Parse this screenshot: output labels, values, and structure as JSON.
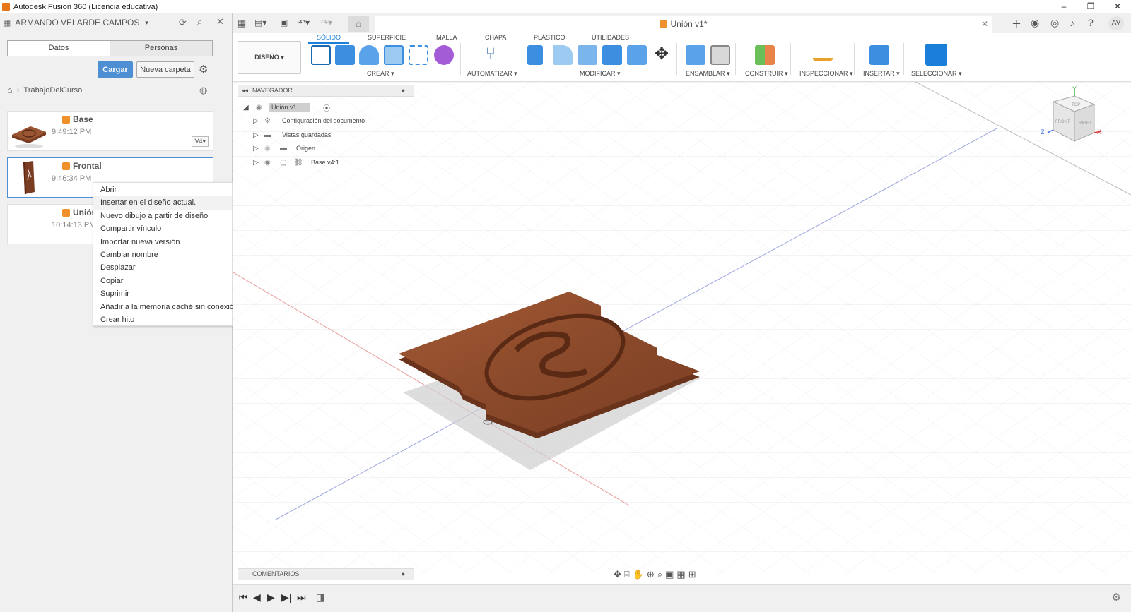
{
  "window": {
    "title": "Autodesk Fusion 360 (Licencia educativa)",
    "minimize": "–",
    "restore": "❐",
    "close": "✕"
  },
  "left_panel": {
    "user_name": "ARMANDO VELARDE CAMPOS",
    "tabs": [
      {
        "label": "Datos",
        "active": true
      },
      {
        "label": "Personas",
        "active": false
      }
    ],
    "upload_label": "Cargar",
    "new_folder_label": "Nueva carpeta",
    "breadcrumb": "TrabajoDelCurso",
    "files": [
      {
        "name": "Base",
        "time": "9:49:12 PM",
        "version": "V4▾"
      },
      {
        "name": "Frontal",
        "time": "9:46:34 PM"
      },
      {
        "name": "Unión",
        "time": "10:14:13 PM"
      }
    ]
  },
  "context_menu": {
    "items": [
      "Abrir",
      "Insertar en el diseño actual.",
      "Nuevo dibujo a partir de diseño",
      "Compartir vínculo",
      "Importar nueva versión",
      "Cambiar nombre",
      "Desplazar",
      "Copiar",
      "Suprimir",
      "Añadir a la memoria caché sin conexión",
      "Crear hito"
    ],
    "highlighted": 1
  },
  "doc_tab": {
    "title": "Unión v1*",
    "close": "✕"
  },
  "user_initials": "AV",
  "ribbon": {
    "tabs": [
      "SÓLIDO",
      "SUPERFICIE",
      "MALLA",
      "CHAPA",
      "PLÁSTICO",
      "UTILIDADES"
    ],
    "active_tab": "SÓLIDO",
    "workspace": "DISEÑO ▾",
    "groups": [
      "CREAR ▾",
      "AUTOMATIZAR ▾",
      "MODIFICAR ▾",
      "ENSAMBLAR ▾",
      "CONSTRUIR ▾",
      "INSPECCIONAR ▾",
      "INSERTAR ▾",
      "SELECCIONAR ▾"
    ]
  },
  "navigator": {
    "title": "NAVEGADOR",
    "root": "Unión v1",
    "items": [
      "Configuración del documento",
      "Vistas guardadas",
      "Origen",
      "Base v4:1"
    ]
  },
  "comments_label": "COMENTARIOS",
  "viewcube": {
    "top": "TOP",
    "front": "FRONT",
    "right": "RIGHT",
    "x": "X",
    "y": "Y",
    "z": "Z"
  },
  "colors": {
    "accent": "#1a7fd8",
    "upload": "#4d8fd2",
    "wood": "#8b4a2b",
    "file_icon": "#f0902a"
  },
  "icons": [
    "grid-icon",
    "refresh-icon",
    "search-icon",
    "close-icon",
    "gear-icon",
    "home-icon",
    "globe-icon",
    "eye-icon",
    "folder-icon",
    "link-icon",
    "play-icon"
  ]
}
